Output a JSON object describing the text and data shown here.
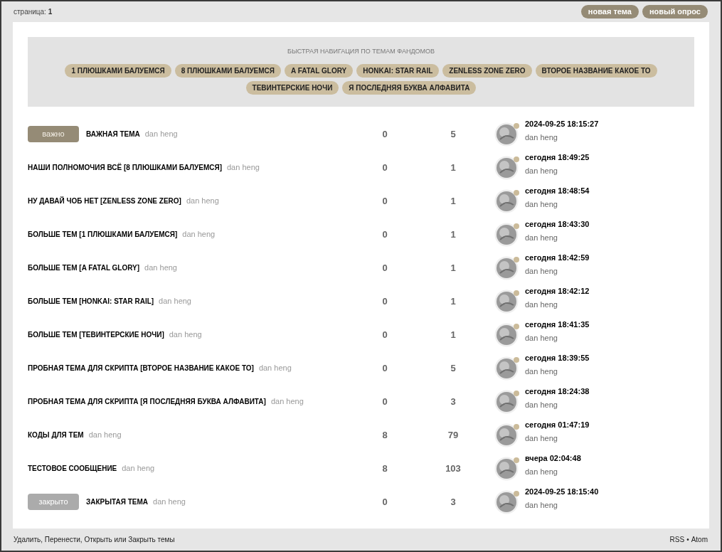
{
  "pagination": {
    "label": "страница:",
    "current": "1"
  },
  "actions": [
    "новая тема",
    "новый опрос"
  ],
  "quick_nav": {
    "title": "БЫСТРАЯ НАВИГАЦИЯ ПО ТЕМАМ ФАНДОМОВ",
    "tags": [
      "1 ПЛЮШКАМИ БАЛУЕМСЯ",
      "8 ПЛЮШКАМИ БАЛУЕМСЯ",
      "A FATAL GLORY",
      "HONKAI: STAR RAIL",
      "ZENLESS ZONE ZERO",
      "ВТОРОЕ НАЗВАНИЕ КАКОЕ ТО",
      "ТЕВИНТЕРСКИЕ НОЧИ",
      "Я ПОСЛЕДНЯЯ БУКВА АЛФАВИТА"
    ]
  },
  "topics": [
    {
      "badge": {
        "kind": "important",
        "label": "важно"
      },
      "title": "ВАЖНАЯ ТЕМА",
      "author": "dan heng",
      "replies": "0",
      "views": "5",
      "last_time": "2024-09-25 18:15:27",
      "last_author": "dan heng"
    },
    {
      "title": "НАШИ ПОЛНОМОЧИЯ ВСЁ [8 ПЛЮШКАМИ БАЛУЕМСЯ]",
      "author": "dan heng",
      "replies": "0",
      "views": "1",
      "last_time": "сегодня 18:49:25",
      "last_author": "dan heng"
    },
    {
      "title": "НУ ДАВАЙ ЧОБ НЕТ [ZENLESS ZONE ZERO]",
      "author": "dan heng",
      "replies": "0",
      "views": "1",
      "last_time": "сегодня 18:48:54",
      "last_author": "dan heng"
    },
    {
      "title": "БОЛЬШЕ ТЕМ [1 ПЛЮШКАМИ БАЛУЕМСЯ]",
      "author": "dan heng",
      "replies": "0",
      "views": "1",
      "last_time": "сегодня 18:43:30",
      "last_author": "dan heng"
    },
    {
      "title": "БОЛЬШЕ ТЕМ [A FATAL GLORY]",
      "author": "dan heng",
      "replies": "0",
      "views": "1",
      "last_time": "сегодня 18:42:59",
      "last_author": "dan heng"
    },
    {
      "title": "БОЛЬШЕ ТЕМ [HONKAI: STAR RAIL]",
      "author": "dan heng",
      "replies": "0",
      "views": "1",
      "last_time": "сегодня 18:42:12",
      "last_author": "dan heng"
    },
    {
      "title": "БОЛЬШЕ ТЕМ [ТЕВИНТЕРСКИЕ НОЧИ]",
      "author": "dan heng",
      "replies": "0",
      "views": "1",
      "last_time": "сегодня 18:41:35",
      "last_author": "dan heng"
    },
    {
      "title": "ПРОБНАЯ ТЕМА ДЛЯ СКРИПТА [ВТОРОЕ НАЗВАНИЕ КАКОЕ ТО]",
      "author": "dan heng",
      "replies": "0",
      "views": "5",
      "last_time": "сегодня 18:39:55",
      "last_author": "dan heng"
    },
    {
      "title": "ПРОБНАЯ ТЕМА ДЛЯ СКРИПТА [Я ПОСЛЕДНЯЯ БУКВА АЛФАВИТА]",
      "author": "dan heng",
      "replies": "0",
      "views": "3",
      "last_time": "сегодня 18:24:38",
      "last_author": "dan heng"
    },
    {
      "title": "КОДЫ ДЛЯ ТЕМ",
      "author": "dan heng",
      "replies": "8",
      "views": "79",
      "last_time": "сегодня 01:47:19",
      "last_author": "dan heng"
    },
    {
      "title": "ТЕСТОВОЕ СООБЩЕНИЕ",
      "author": "dan heng",
      "replies": "8",
      "views": "103",
      "last_time": "вчера 02:04:48",
      "last_author": "dan heng"
    },
    {
      "badge": {
        "kind": "closed",
        "label": "закрыто"
      },
      "title": "ЗАКРЫТАЯ ТЕМА",
      "author": "dan heng",
      "replies": "0",
      "views": "3",
      "last_time": "2024-09-25 18:15:40",
      "last_author": "dan heng"
    }
  ],
  "footer": {
    "moderation": "Удалить, Перенести, Открыть или Закрыть темы",
    "feeds": [
      "RSS",
      "Atom"
    ],
    "separator": "•"
  }
}
